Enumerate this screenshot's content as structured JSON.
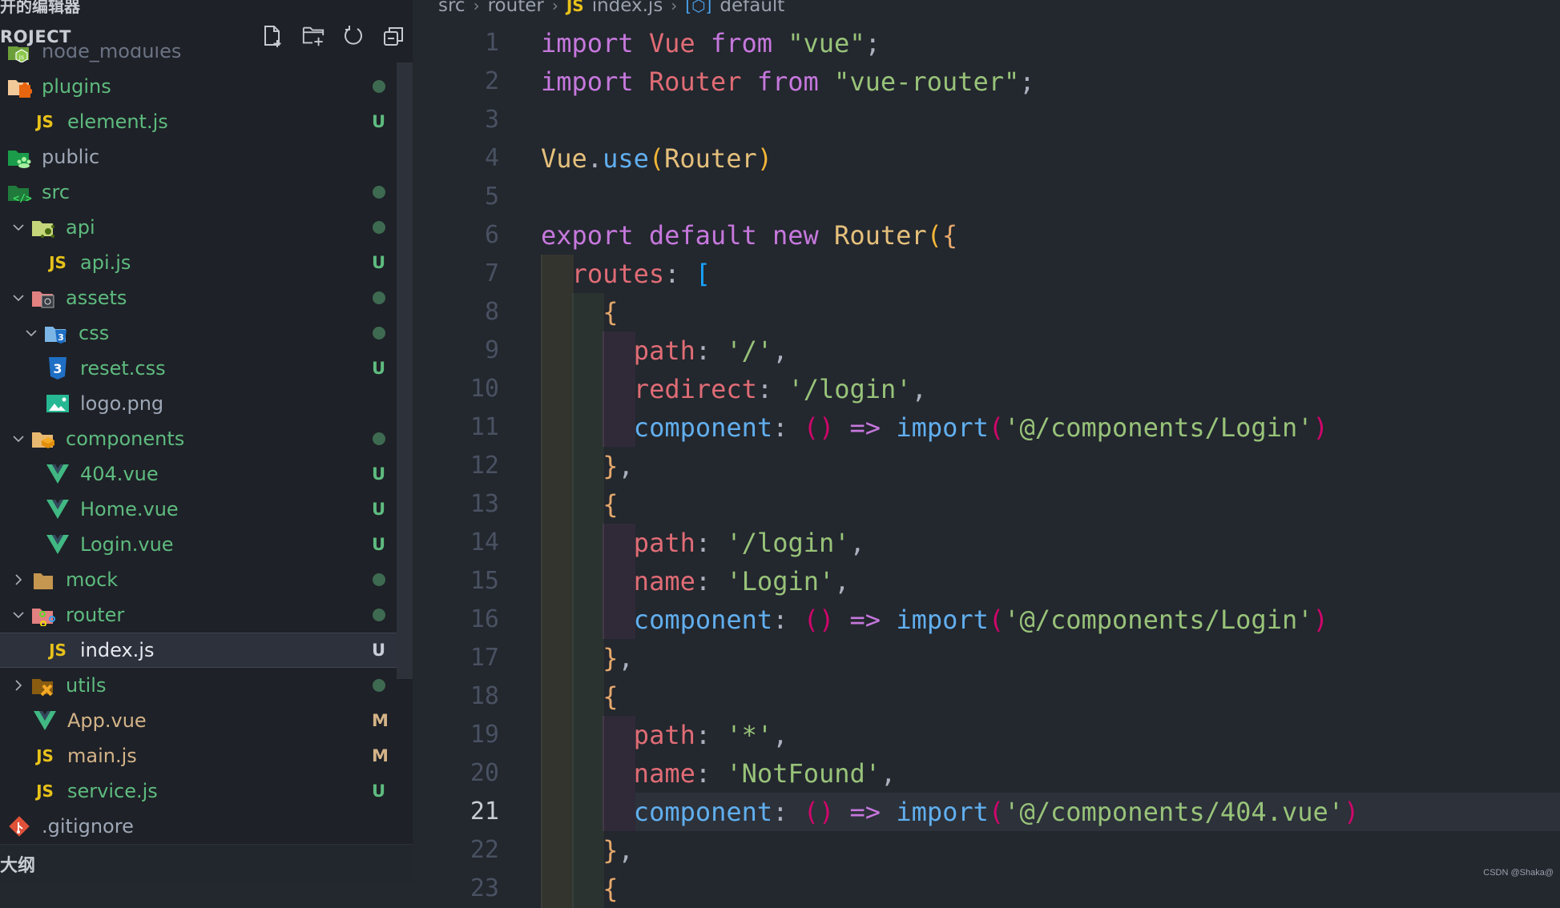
{
  "sidebar": {
    "title": "开的编辑器",
    "project_label": "ROJECT",
    "actions": [
      {
        "name": "new-file",
        "icon": "new-file-icon"
      },
      {
        "name": "new-folder",
        "icon": "new-folder-icon"
      },
      {
        "name": "refresh",
        "icon": "refresh-icon"
      },
      {
        "name": "collapse-all",
        "icon": "collapse-all-icon"
      }
    ],
    "tree": [
      {
        "label": "node_modules",
        "depth": 0,
        "type": "folder",
        "icon": "node-folder-icon",
        "chevron": "",
        "status": "",
        "color": "dim"
      },
      {
        "label": "plugins",
        "depth": 0,
        "type": "folder",
        "icon": "plugins-folder-icon",
        "chevron": "",
        "status": "dot",
        "color": "u"
      },
      {
        "label": "element.js",
        "depth": 1,
        "type": "file",
        "icon": "js-file-icon",
        "chevron": "",
        "status": "U",
        "color": "u"
      },
      {
        "label": "public",
        "depth": 0,
        "type": "folder",
        "icon": "public-folder-icon",
        "chevron": "",
        "status": "",
        "color": "plain"
      },
      {
        "label": "src",
        "depth": 0,
        "type": "folder",
        "icon": "src-folder-icon",
        "chevron": "",
        "status": "dot",
        "color": "u"
      },
      {
        "label": "api",
        "depth": 1,
        "type": "folder",
        "icon": "api-folder-icon",
        "chevron": "open",
        "status": "dot",
        "color": "u"
      },
      {
        "label": "api.js",
        "depth": 2,
        "type": "file",
        "icon": "js-file-icon",
        "chevron": "",
        "status": "U",
        "color": "u"
      },
      {
        "label": "assets",
        "depth": 1,
        "type": "folder",
        "icon": "assets-folder-icon",
        "chevron": "open",
        "status": "dot",
        "color": "u"
      },
      {
        "label": "css",
        "depth": 2,
        "type": "folder",
        "icon": "css-folder-icon",
        "chevron": "open",
        "status": "dot",
        "color": "u"
      },
      {
        "label": "reset.css",
        "depth": 3,
        "type": "file",
        "icon": "css-file-icon",
        "chevron": "",
        "status": "U",
        "color": "u"
      },
      {
        "label": "logo.png",
        "depth": 2,
        "type": "file",
        "icon": "image-file-icon",
        "chevron": "",
        "status": "",
        "color": "plain"
      },
      {
        "label": "components",
        "depth": 1,
        "type": "folder",
        "icon": "components-folder-icon",
        "chevron": "open",
        "status": "dot",
        "color": "u"
      },
      {
        "label": "404.vue",
        "depth": 2,
        "type": "file",
        "icon": "vue-file-icon",
        "chevron": "",
        "status": "U",
        "color": "u"
      },
      {
        "label": "Home.vue",
        "depth": 2,
        "type": "file",
        "icon": "vue-file-icon",
        "chevron": "",
        "status": "U",
        "color": "u"
      },
      {
        "label": "Login.vue",
        "depth": 2,
        "type": "file",
        "icon": "vue-file-icon",
        "chevron": "",
        "status": "U",
        "color": "u"
      },
      {
        "label": "mock",
        "depth": 1,
        "type": "folder",
        "icon": "mock-folder-icon",
        "chevron": "closed",
        "status": "dot",
        "color": "u"
      },
      {
        "label": "router",
        "depth": 1,
        "type": "folder",
        "icon": "router-folder-icon",
        "chevron": "open",
        "status": "dot",
        "color": "u"
      },
      {
        "label": "index.js",
        "depth": 2,
        "type": "file",
        "icon": "js-file-icon",
        "chevron": "",
        "status": "U",
        "color": "selected",
        "selected": true
      },
      {
        "label": "utils",
        "depth": 1,
        "type": "folder",
        "icon": "utils-folder-icon",
        "chevron": "closed",
        "status": "dot",
        "color": "u"
      },
      {
        "label": "App.vue",
        "depth": 1,
        "type": "file",
        "icon": "vue-file-icon",
        "chevron": "",
        "status": "M",
        "color": "m"
      },
      {
        "label": "main.js",
        "depth": 1,
        "type": "file",
        "icon": "js-file-icon",
        "chevron": "",
        "status": "M",
        "color": "m"
      },
      {
        "label": "service.js",
        "depth": 1,
        "type": "file",
        "icon": "js-file-icon",
        "chevron": "",
        "status": "U",
        "color": "u"
      },
      {
        "label": ".gitignore",
        "depth": 0,
        "type": "file",
        "icon": "git-file-icon",
        "chevron": "",
        "status": "",
        "color": "plain"
      }
    ],
    "outline_label": "大纲"
  },
  "breadcrumb": {
    "items": [
      "src",
      "router",
      "index.js",
      "default"
    ],
    "file_icon": "JS"
  },
  "editor": {
    "active_line": 21,
    "lines": [
      {
        "n": 1,
        "indent": 0,
        "tokens": [
          [
            "kw",
            "import"
          ],
          [
            "punc",
            " "
          ],
          [
            "cls",
            "Vue"
          ],
          [
            "punc",
            " "
          ],
          [
            "kw",
            "from"
          ],
          [
            "punc",
            " "
          ],
          [
            "str",
            "\"vue\""
          ],
          [
            "punc",
            ";"
          ]
        ]
      },
      {
        "n": 2,
        "indent": 0,
        "tokens": [
          [
            "kw",
            "import"
          ],
          [
            "punc",
            " "
          ],
          [
            "cls",
            "Router"
          ],
          [
            "punc",
            " "
          ],
          [
            "kw",
            "from"
          ],
          [
            "punc",
            " "
          ],
          [
            "str",
            "\"vue-router\""
          ],
          [
            "punc",
            ";"
          ]
        ]
      },
      {
        "n": 3,
        "indent": 0,
        "tokens": []
      },
      {
        "n": 4,
        "indent": 0,
        "tokens": [
          [
            "typ",
            "Vue"
          ],
          [
            "punc",
            "."
          ],
          [
            "fn",
            "use"
          ],
          [
            "br1",
            "("
          ],
          [
            "typ",
            "Router"
          ],
          [
            "br1",
            ")"
          ]
        ]
      },
      {
        "n": 5,
        "indent": 0,
        "tokens": []
      },
      {
        "n": 6,
        "indent": 0,
        "tokens": [
          [
            "kw",
            "export"
          ],
          [
            "punc",
            " "
          ],
          [
            "kw",
            "default"
          ],
          [
            "punc",
            " "
          ],
          [
            "kw",
            "new"
          ],
          [
            "punc",
            " "
          ],
          [
            "typ",
            "Router"
          ],
          [
            "br1",
            "("
          ],
          [
            "brc",
            "{"
          ]
        ]
      },
      {
        "n": 7,
        "indent": 1,
        "tokens": [
          [
            "prop",
            "routes"
          ],
          [
            "punc",
            ": "
          ],
          [
            "br3",
            "["
          ]
        ]
      },
      {
        "n": 8,
        "indent": 2,
        "tokens": [
          [
            "brc",
            "{"
          ]
        ]
      },
      {
        "n": 9,
        "indent": 3,
        "tokens": [
          [
            "prop",
            "path"
          ],
          [
            "punc",
            ": "
          ],
          [
            "str",
            "'/'"
          ],
          [
            "punc",
            ","
          ]
        ]
      },
      {
        "n": 10,
        "indent": 3,
        "tokens": [
          [
            "prop",
            "redirect"
          ],
          [
            "punc",
            ": "
          ],
          [
            "str",
            "'/login'"
          ],
          [
            "punc",
            ","
          ]
        ]
      },
      {
        "n": 11,
        "indent": 3,
        "tokens": [
          [
            "fn",
            "component"
          ],
          [
            "punc",
            ": "
          ],
          [
            "br2",
            "()"
          ],
          [
            "punc",
            " "
          ],
          [
            "kw",
            "=>"
          ],
          [
            "punc",
            " "
          ],
          [
            "fn",
            "import"
          ],
          [
            "br2",
            "("
          ],
          [
            "str",
            "'@/components/Login'"
          ],
          [
            "br2",
            ")"
          ]
        ]
      },
      {
        "n": 12,
        "indent": 2,
        "tokens": [
          [
            "brc",
            "}"
          ],
          [
            "punc",
            ","
          ]
        ]
      },
      {
        "n": 13,
        "indent": 2,
        "tokens": [
          [
            "brc",
            "{"
          ]
        ]
      },
      {
        "n": 14,
        "indent": 3,
        "tokens": [
          [
            "prop",
            "path"
          ],
          [
            "punc",
            ": "
          ],
          [
            "str",
            "'/login'"
          ],
          [
            "punc",
            ","
          ]
        ]
      },
      {
        "n": 15,
        "indent": 3,
        "tokens": [
          [
            "prop",
            "name"
          ],
          [
            "punc",
            ": "
          ],
          [
            "str",
            "'Login'"
          ],
          [
            "punc",
            ","
          ]
        ]
      },
      {
        "n": 16,
        "indent": 3,
        "tokens": [
          [
            "fn",
            "component"
          ],
          [
            "punc",
            ": "
          ],
          [
            "br2",
            "()"
          ],
          [
            "punc",
            " "
          ],
          [
            "kw",
            "=>"
          ],
          [
            "punc",
            " "
          ],
          [
            "fn",
            "import"
          ],
          [
            "br2",
            "("
          ],
          [
            "str",
            "'@/components/Login'"
          ],
          [
            "br2",
            ")"
          ]
        ]
      },
      {
        "n": 17,
        "indent": 2,
        "tokens": [
          [
            "brc",
            "}"
          ],
          [
            "punc",
            ","
          ]
        ]
      },
      {
        "n": 18,
        "indent": 2,
        "tokens": [
          [
            "brc",
            "{"
          ]
        ]
      },
      {
        "n": 19,
        "indent": 3,
        "tokens": [
          [
            "prop",
            "path"
          ],
          [
            "punc",
            ": "
          ],
          [
            "str",
            "'*'"
          ],
          [
            "punc",
            ","
          ]
        ]
      },
      {
        "n": 20,
        "indent": 3,
        "tokens": [
          [
            "prop",
            "name"
          ],
          [
            "punc",
            ": "
          ],
          [
            "str",
            "'NotFound'"
          ],
          [
            "punc",
            ","
          ]
        ]
      },
      {
        "n": 21,
        "indent": 3,
        "tokens": [
          [
            "fn",
            "component"
          ],
          [
            "punc",
            ": "
          ],
          [
            "br2",
            "()"
          ],
          [
            "punc",
            " "
          ],
          [
            "kw",
            "=>"
          ],
          [
            "punc",
            " "
          ],
          [
            "fn",
            "import"
          ],
          [
            "br2",
            "("
          ],
          [
            "str",
            "'@/components/404.vue'"
          ],
          [
            "br2",
            ")"
          ]
        ]
      },
      {
        "n": 22,
        "indent": 2,
        "tokens": [
          [
            "brc",
            "}"
          ],
          [
            "punc",
            ","
          ]
        ]
      },
      {
        "n": 23,
        "indent": 2,
        "tokens": [
          [
            "brc",
            "{"
          ]
        ]
      }
    ]
  },
  "watermark": "CSDN @Shaka@",
  "colors": {
    "sidebar_bg": "#1e2127",
    "editor_bg": "#23272e",
    "untracked": "#5ebb7f",
    "modified": "#d4b388",
    "js_badge": "#e8c21a"
  }
}
